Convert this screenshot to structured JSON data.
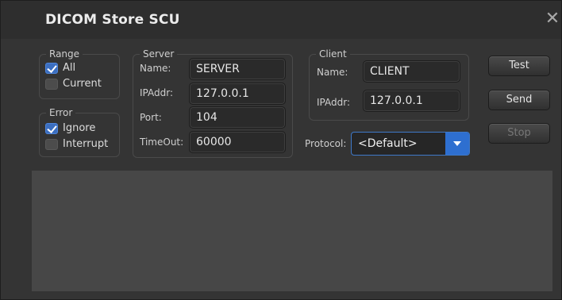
{
  "window": {
    "title": "DICOM Store SCU"
  },
  "range": {
    "legend": "Range",
    "options": [
      {
        "label": "All",
        "checked": true
      },
      {
        "label": "Current",
        "checked": false
      }
    ]
  },
  "error": {
    "legend": "Error",
    "options": [
      {
        "label": "Ignore",
        "checked": true
      },
      {
        "label": "Interrupt",
        "checked": false
      }
    ]
  },
  "server": {
    "legend": "Server",
    "name_label": "Name:",
    "name_value": "SERVER",
    "ip_label": "IPAddr:",
    "ip_value": "127.0.0.1",
    "port_label": "Port:",
    "port_value": "104",
    "timeout_label": "TimeOut:",
    "timeout_value": "60000"
  },
  "client": {
    "legend": "Client",
    "name_label": "Name:",
    "name_value": "CLIENT",
    "ip_label": "IPAddr:",
    "ip_value": "127.0.0.1"
  },
  "protocol": {
    "label": "Protocol:",
    "selected": "<Default>"
  },
  "buttons": {
    "test": "Test",
    "send": "Send",
    "stop": "Stop"
  },
  "icons": {
    "close": "close-icon",
    "dropdown": "chevron-down-icon",
    "check": "checkmark-icon"
  },
  "colors": {
    "background": "#343434",
    "accent": "#2e6fd0",
    "field_bg": "#2a2a2a",
    "output_bg": "#474747"
  }
}
